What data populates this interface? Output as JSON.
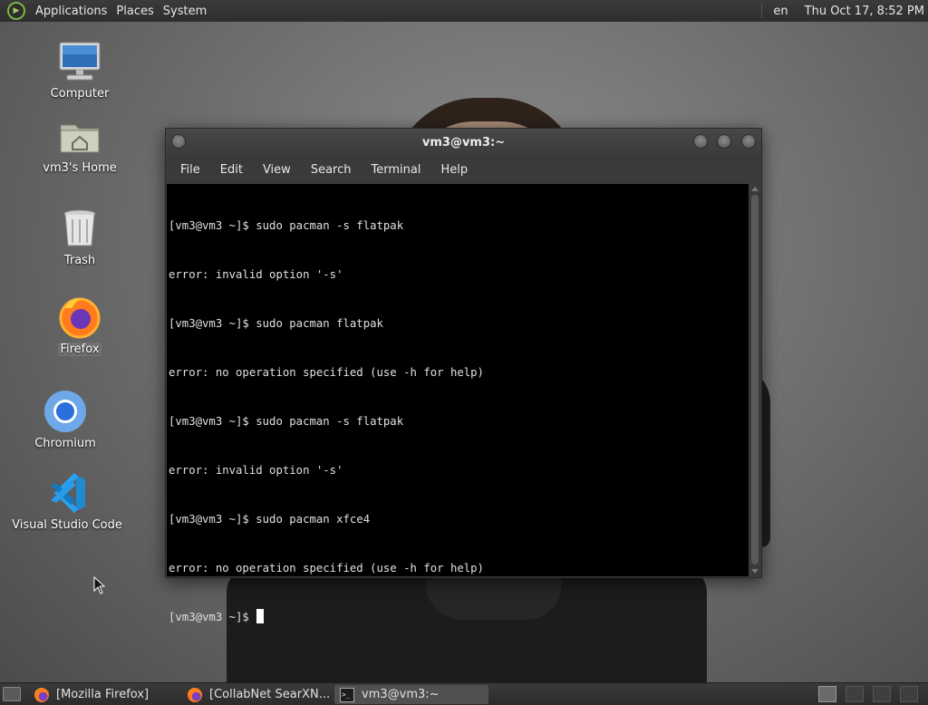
{
  "top_panel": {
    "menus": [
      "Applications",
      "Places",
      "System"
    ],
    "language": "en",
    "clock": "Thu Oct 17,  8:52 PM"
  },
  "desktop": {
    "icons": [
      {
        "label": "Computer",
        "icon": "computer-icon"
      },
      {
        "label": "vm3's Home",
        "icon": "home-folder-icon"
      },
      {
        "label": "Trash",
        "icon": "trash-icon"
      },
      {
        "label": "Firefox",
        "icon": "firefox-icon"
      },
      {
        "label": "Chromium",
        "icon": "chromium-icon"
      },
      {
        "label": "Visual Studio Code",
        "icon": "vscode-icon"
      }
    ]
  },
  "terminal": {
    "title": "vm3@vm3:~",
    "menu": [
      "File",
      "Edit",
      "View",
      "Search",
      "Terminal",
      "Help"
    ],
    "lines": [
      "[vm3@vm3 ~]$ sudo pacman -s flatpak",
      "error: invalid option '-s'",
      "[vm3@vm3 ~]$ sudo pacman flatpak",
      "error: no operation specified (use -h for help)",
      "[vm3@vm3 ~]$ sudo pacman -s flatpak",
      "error: invalid option '-s'",
      "[vm3@vm3 ~]$ sudo pacman xfce4",
      "error: no operation specified (use -h for help)"
    ],
    "prompt": "[vm3@vm3 ~]$ "
  },
  "taskbar": {
    "tasks": [
      {
        "label": "[Mozilla Firefox]",
        "icon": "firefox-icon",
        "active": false
      },
      {
        "label": "[CollabNet SearXN...",
        "icon": "firefox-icon",
        "active": false
      },
      {
        "label": "vm3@vm3:~",
        "icon": "terminal-icon",
        "active": true
      }
    ]
  },
  "colors": {
    "panel": "#2d2d2d",
    "terminal_bg": "#000000",
    "terminal_fg": "#e0e0e0",
    "accent_green": "#7cb342"
  }
}
